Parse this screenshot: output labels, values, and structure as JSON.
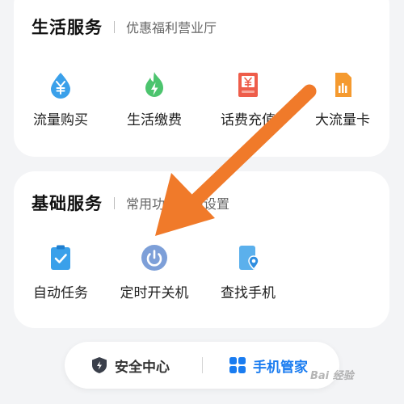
{
  "life_services": {
    "title": "生活服务",
    "subtitle": "优惠福利营业厅",
    "items": [
      {
        "label": "流量购买",
        "icon": "water-drop-yuan-icon"
      },
      {
        "label": "生活缴费",
        "icon": "flame-bolt-icon"
      },
      {
        "label": "话费充值",
        "icon": "bill-yuan-icon"
      },
      {
        "label": "大流量卡",
        "icon": "sim-card-icon"
      }
    ]
  },
  "basic_services": {
    "title": "基础服务",
    "subtitle": "常用功能快捷设置",
    "items": [
      {
        "label": "自动任务",
        "icon": "clipboard-check-icon"
      },
      {
        "label": "定时开关机",
        "icon": "power-icon"
      },
      {
        "label": "查找手机",
        "icon": "find-phone-icon"
      }
    ]
  },
  "bottom_bar": {
    "security_label": "安全中心",
    "manager_label": "手机管家"
  },
  "watermark": "Bai 经验",
  "colors": {
    "annotation_arrow": "#f07a2a",
    "accent_blue": "#1a7cf0",
    "icon_blue": "#3aa0ea",
    "icon_green": "#4cc46e",
    "icon_red": "#ee5d4a",
    "icon_orange": "#f59a2f"
  }
}
